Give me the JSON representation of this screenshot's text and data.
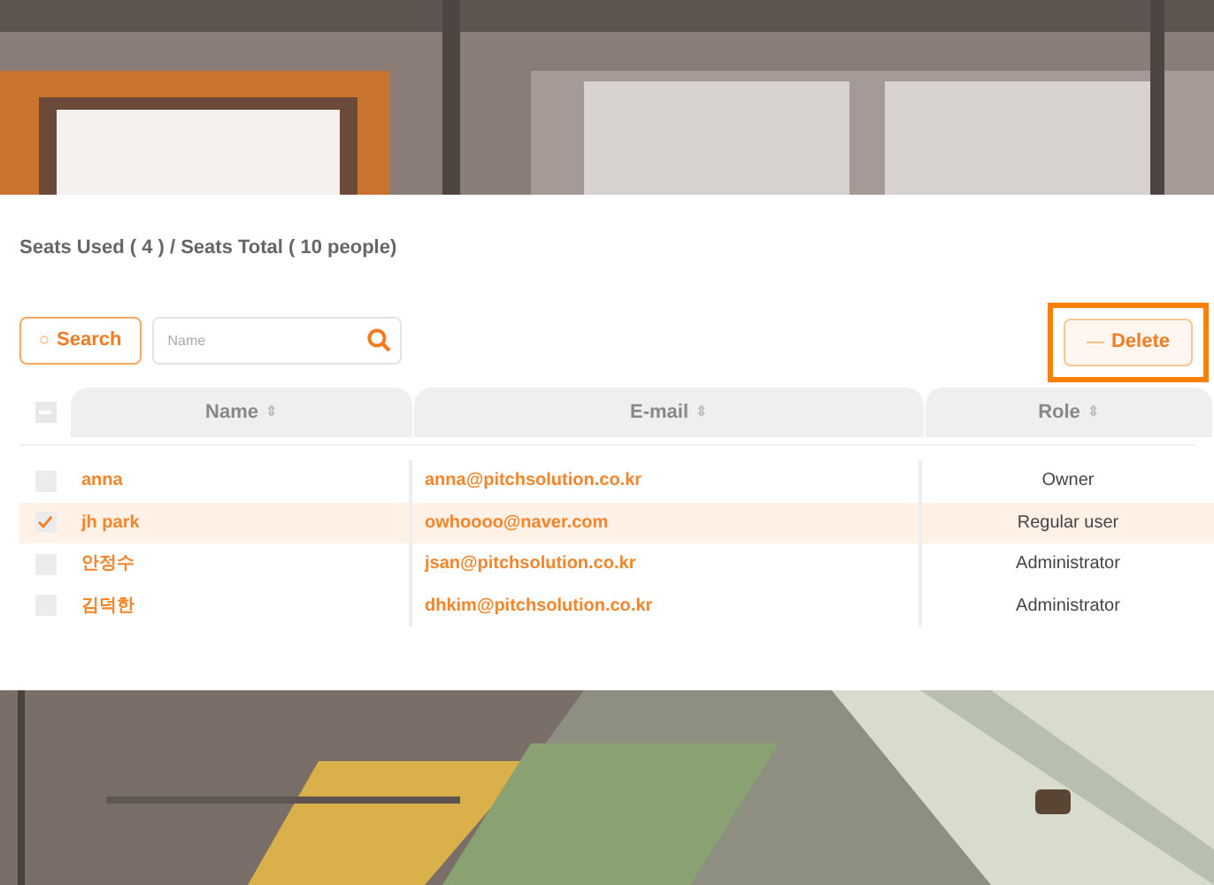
{
  "summary": "Seats Used ( 4 ) / Seats Total ( 10 people)",
  "search_button": {
    "icon": "○",
    "label": "Search"
  },
  "search_field": {
    "placeholder": "Name"
  },
  "delete_button": {
    "icon": "—",
    "label": "Delete",
    "highlighted": true
  },
  "table": {
    "select_all": {
      "indeterminate": true
    },
    "columns": [
      {
        "label": "Name",
        "sort": "⇕"
      },
      {
        "label": "E-mail",
        "sort": "⇕"
      },
      {
        "label": "Role",
        "sort": "⇕"
      }
    ],
    "rows": [
      {
        "selected": false,
        "name": "anna",
        "email": "anna@pitchsolution.co.kr",
        "role": "Owner"
      },
      {
        "selected": true,
        "name": "jh park",
        "email": "owhoooo@naver.com",
        "role": "Regular user"
      },
      {
        "selected": false,
        "name": "안정수",
        "email": "jsan@pitchsolution.co.kr",
        "role": "Administrator"
      },
      {
        "selected": false,
        "name": "김덕한",
        "email": "dhkim@pitchsolution.co.kr",
        "role": "Administrator"
      }
    ]
  }
}
